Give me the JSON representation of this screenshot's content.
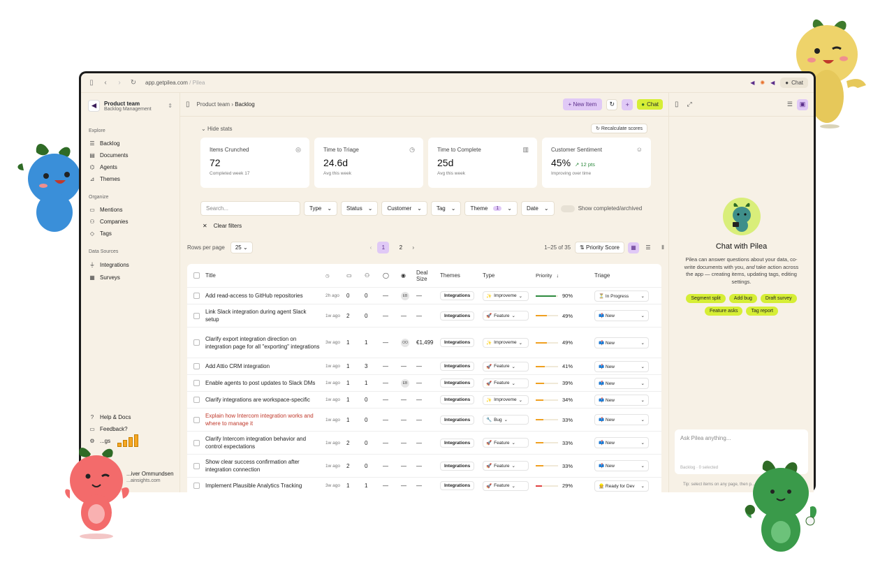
{
  "browser": {
    "url_host": "app.getpilea.com",
    "url_sep": " / ",
    "url_page": "Pilea",
    "chat_label": "Chat"
  },
  "sidebar": {
    "team_name": "Product team",
    "team_sub": "Backlog Management",
    "explore_label": "Explore",
    "explore": [
      {
        "label": "Backlog",
        "icon": "list-icon"
      },
      {
        "label": "Documents",
        "icon": "document-icon"
      },
      {
        "label": "Agents",
        "icon": "agent-icon"
      },
      {
        "label": "Themes",
        "icon": "chart-icon"
      }
    ],
    "organize_label": "Organize",
    "organize": [
      {
        "label": "Mentions",
        "icon": "mention-icon"
      },
      {
        "label": "Companies",
        "icon": "companies-icon"
      },
      {
        "label": "Tags",
        "icon": "tag-icon"
      }
    ],
    "datasources_label": "Data Sources",
    "datasources": [
      {
        "label": "Integrations",
        "icon": "plug-icon"
      },
      {
        "label": "Surveys",
        "icon": "survey-icon"
      }
    ],
    "help": "Help & Docs",
    "feedback": "Feedback?",
    "settings_partial": "...gs",
    "user_name": "...iver Ommundsen",
    "user_email": "...ainsights.com"
  },
  "topbar": {
    "crumb_parent": "Product team",
    "crumb_current": "Backlog",
    "new_item": "New Item",
    "chat": "Chat"
  },
  "stats": {
    "toggle": "Hide stats",
    "recalc": "Recalculate scores",
    "cards": [
      {
        "label": "Items Crunched",
        "value": "72",
        "sub": "Completed week 17",
        "delta": ""
      },
      {
        "label": "Time to Triage",
        "value": "24.6d",
        "sub": "Avg this week",
        "delta": ""
      },
      {
        "label": "Time to Complete",
        "value": "25d",
        "sub": "Avg this week",
        "delta": ""
      },
      {
        "label": "Customer Sentiment",
        "value": "45%",
        "sub": "Improving over time",
        "delta": "12 pts"
      }
    ]
  },
  "filters": {
    "search_placeholder": "Search...",
    "type": "Type",
    "status": "Status",
    "customer": "Customer",
    "tag": "Tag",
    "theme": "Theme",
    "theme_count": "1",
    "date": "Date",
    "show_completed": "Show completed/archived",
    "clear": "Clear filters"
  },
  "pager": {
    "rows_label": "Rows per page",
    "rows_value": "25",
    "page1": "1",
    "page2": "2",
    "range": "1–25 of 35",
    "sort": "Priority Score"
  },
  "table": {
    "headers": {
      "title": "Title",
      "deal": "Deal Size",
      "themes": "Themes",
      "type": "Type",
      "priority": "Priority",
      "triage": "Triage"
    },
    "rows": [
      {
        "title": "Add read-access to GitHub repositories",
        "time": "2h ago",
        "n1": "0",
        "n2": "0",
        "n3": "—",
        "av": "EB",
        "deal": "—",
        "theme": "Integrations",
        "type": "Improveme",
        "type_icon": "✨",
        "prio": "90%",
        "prio_frac": 0.9,
        "prio_color": "#2d8a3e",
        "triage": "In Progress",
        "triage_icon": "⏳",
        "title_color": "#222"
      },
      {
        "title": "Link Slack integration during agent Slack setup",
        "time": "1w ago",
        "n1": "2",
        "n2": "0",
        "n3": "—",
        "av": "",
        "deal": "—",
        "theme": "Integrations",
        "type": "Feature",
        "type_icon": "🚀",
        "prio": "49%",
        "prio_frac": 0.49,
        "prio_color": "#f0a020",
        "triage": "New",
        "triage_icon": "📫",
        "title_color": "#222"
      },
      {
        "title": "Clarify export integration direction on integration page for all \"exporting\" integrations",
        "time": "3w ago",
        "n1": "1",
        "n2": "1",
        "n3": "—",
        "av": "OO",
        "deal": "€1,499",
        "theme": "Integrations",
        "type": "Improveme",
        "type_icon": "✨",
        "prio": "49%",
        "prio_frac": 0.49,
        "prio_color": "#f0a020",
        "triage": "New",
        "triage_icon": "📫",
        "title_color": "#222"
      },
      {
        "title": "Add Attio CRM integration",
        "time": "1w ago",
        "n1": "1",
        "n2": "3",
        "n3": "—",
        "av": "",
        "deal": "—",
        "theme": "Integrations",
        "type": "Feature",
        "type_icon": "🚀",
        "prio": "41%",
        "prio_frac": 0.41,
        "prio_color": "#f0a020",
        "triage": "New",
        "triage_icon": "📫",
        "title_color": "#222"
      },
      {
        "title": "Enable agents to post updates to Slack DMs",
        "time": "1w ago",
        "n1": "1",
        "n2": "1",
        "n3": "—",
        "av": "EB",
        "deal": "—",
        "theme": "Integrations",
        "type": "Feature",
        "type_icon": "🚀",
        "prio": "39%",
        "prio_frac": 0.39,
        "prio_color": "#f0a020",
        "triage": "New",
        "triage_icon": "📫",
        "title_color": "#222"
      },
      {
        "title": "Clarify integrations are workspace-specific",
        "time": "1w ago",
        "n1": "1",
        "n2": "0",
        "n3": "—",
        "av": "",
        "deal": "—",
        "theme": "Integrations",
        "type": "Improveme",
        "type_icon": "✨",
        "prio": "34%",
        "prio_frac": 0.34,
        "prio_color": "#f0a020",
        "triage": "New",
        "triage_icon": "📫",
        "title_color": "#222"
      },
      {
        "title": "Explain how Intercom integration works and where to manage it",
        "time": "1w ago",
        "n1": "1",
        "n2": "0",
        "n3": "—",
        "av": "",
        "deal": "—",
        "theme": "Integrations",
        "type": "Bug",
        "type_icon": "🔧",
        "prio": "33%",
        "prio_frac": 0.33,
        "prio_color": "#f0a020",
        "triage": "New",
        "triage_icon": "📫",
        "title_color": "#c0392b"
      },
      {
        "title": "Clarify Intercom integration behavior and control expectations",
        "time": "1w ago",
        "n1": "2",
        "n2": "0",
        "n3": "—",
        "av": "",
        "deal": "—",
        "theme": "Integrations",
        "type": "Feature",
        "type_icon": "🚀",
        "prio": "33%",
        "prio_frac": 0.33,
        "prio_color": "#f0a020",
        "triage": "New",
        "triage_icon": "📫",
        "title_color": "#222"
      },
      {
        "title": "Show clear success confirmation after integration connection",
        "time": "1w ago",
        "n1": "2",
        "n2": "0",
        "n3": "—",
        "av": "",
        "deal": "—",
        "theme": "Integrations",
        "type": "Feature",
        "type_icon": "🚀",
        "prio": "33%",
        "prio_frac": 0.33,
        "prio_color": "#f0a020",
        "triage": "New",
        "triage_icon": "📫",
        "title_color": "#222"
      },
      {
        "title": "Implement Plausible Analytics Tracking",
        "time": "3w ago",
        "n1": "1",
        "n2": "1",
        "n3": "—",
        "av": "",
        "deal": "—",
        "theme": "Integrations",
        "type": "Feature",
        "type_icon": "🚀",
        "prio": "29%",
        "prio_frac": 0.29,
        "prio_color": "#e04040",
        "triage": "Ready for Dev",
        "triage_icon": "👷",
        "title_color": "#222"
      }
    ]
  },
  "chat": {
    "title": "Chat with Pilea",
    "desc_a": "Pilea can answer questions about your data, co-write documents with you, ",
    "desc_and": "and",
    "desc_b": " take action across the app — creating items, updating tags, editing settings.",
    "chips": [
      "Segment split",
      "Add bug",
      "Draft survey",
      "Feature asks",
      "Tag report"
    ],
    "input_placeholder": "Ask Pilea anything...",
    "context": "Backlog · 0 selected",
    "tip": "Tip: select items on any page, then p..."
  }
}
